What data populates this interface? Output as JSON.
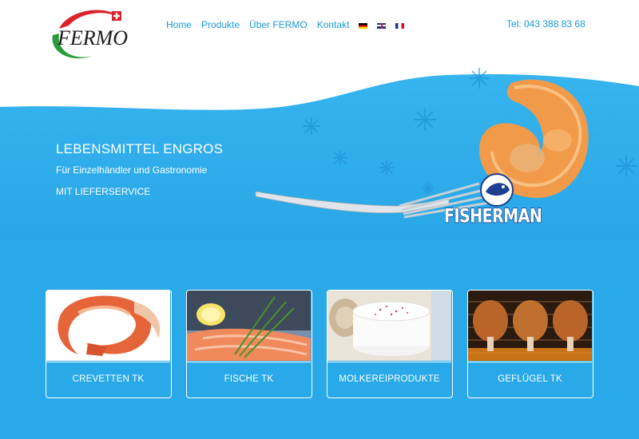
{
  "brand": {
    "logo_text": "FERMO"
  },
  "nav": {
    "items": [
      {
        "label": "Home"
      },
      {
        "label": "Produkte"
      },
      {
        "label": "Über FERMO"
      },
      {
        "label": "Kontakt"
      }
    ],
    "languages": [
      "de-flag-icon",
      "en-flag-icon",
      "fr-flag-icon"
    ]
  },
  "header": {
    "phone": "Tel: 043 388 83 68"
  },
  "hero": {
    "title": "LEBENSMITTEL ENGROS",
    "subtitle": "Für Einzelhändler und Gastronomie",
    "service": "MIT LIEFERSERVICE",
    "brand_label": "FISHERMAN"
  },
  "products": [
    {
      "label": "CREVETTEN TK",
      "icon": "shrimp-icon"
    },
    {
      "label": "FISCHE TK",
      "icon": "salmon-icon"
    },
    {
      "label": "MOLKEREIPRODUKTE",
      "icon": "cheese-icon"
    },
    {
      "label": "GEFLÜGEL TK",
      "icon": "chicken-icon"
    }
  ],
  "colors": {
    "accent": "#1a9ad6",
    "hero_blue": "#29a9e8",
    "logo_red": "#d8232a",
    "logo_green": "#2a9a3a"
  }
}
